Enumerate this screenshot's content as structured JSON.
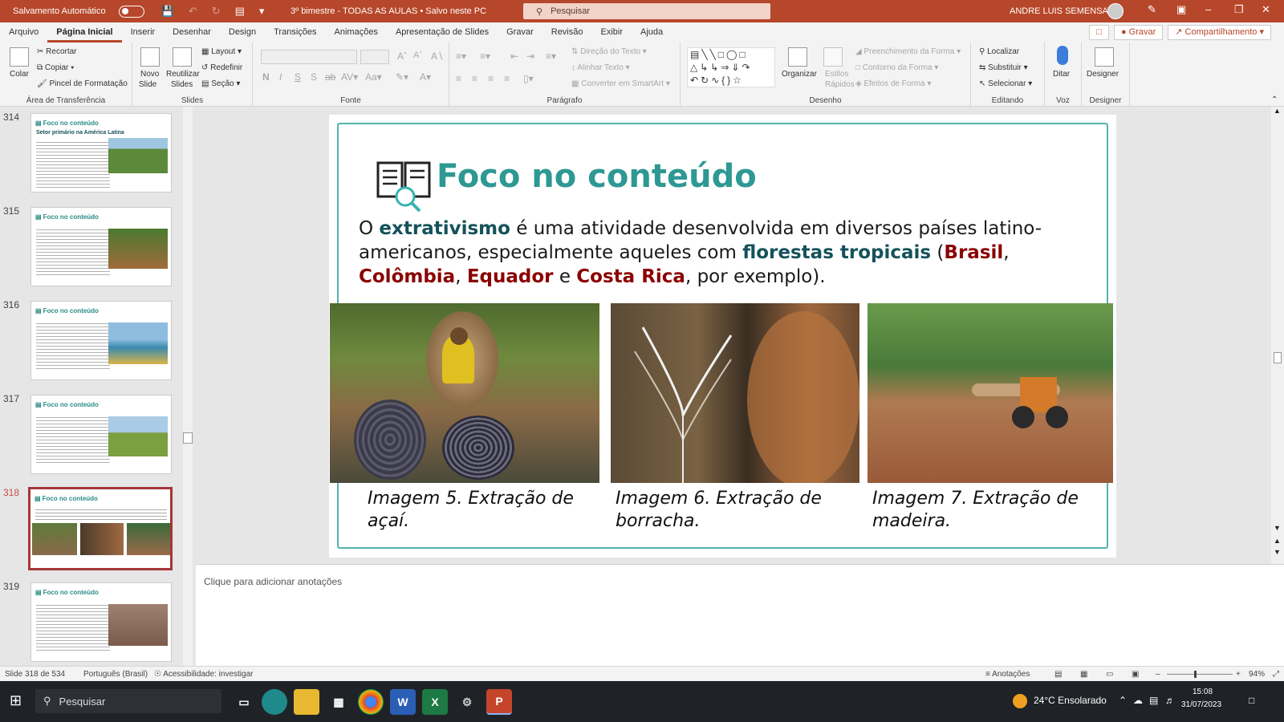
{
  "titlebar": {
    "autosave_label": "Salvamento Automático",
    "doc_title": "3º bimestre - TODAS AS AULAS • Salvo neste PC",
    "search_placeholder": "Pesquisar",
    "user_name": "ANDRE LUIS SEMENSATO"
  },
  "menu": {
    "tabs": [
      "Arquivo",
      "Página Inicial",
      "Inserir",
      "Desenhar",
      "Design",
      "Transições",
      "Animações",
      "Apresentação de Slides",
      "Gravar",
      "Revisão",
      "Exibir",
      "Ajuda"
    ],
    "record_label": "Gravar",
    "share_label": "Compartilhamento"
  },
  "ribbon": {
    "clipboard": {
      "paste": "Colar",
      "cut": "Recortar",
      "copy": "Copiar",
      "format_painter": "Pincel de Formatação",
      "label": "Área de Transferência"
    },
    "slides": {
      "new_slide_line1": "Novo",
      "new_slide_line2": "Slide",
      "reuse_line1": "Reutilizar",
      "reuse_line2": "Slides",
      "layout": "Layout",
      "reset": "Redefinir",
      "section": "Seção",
      "label": "Slides"
    },
    "font": {
      "label": "Fonte",
      "bold": "N",
      "italic": "I",
      "underline": "S"
    },
    "paragraph": {
      "text_direction": "Direção do Texto",
      "align_text": "Alinhar Texto",
      "smartart": "Converter em SmartArt",
      "label": "Parágrafo"
    },
    "drawing": {
      "arrange": "Organizar",
      "quick_styles_line1": "Estilos",
      "quick_styles_line2": "Rápidos",
      "shape_fill": "Preenchimento da Forma",
      "shape_outline": "Contorno da Forma",
      "shape_effects": "Efeitos de Forma",
      "label": "Desenho"
    },
    "editing": {
      "find": "Localizar",
      "replace": "Substituir",
      "select": "Selecionar",
      "label": "Editando"
    },
    "voice": {
      "dictate": "Ditar",
      "label": "Voz"
    },
    "designer": {
      "designer": "Designer",
      "label": "Designer"
    }
  },
  "thumbnails": [
    {
      "num": "314",
      "title": "Foco no conteúdo",
      "subtitle": "Setor primário na América Latina",
      "selected": false
    },
    {
      "num": "315",
      "title": "Foco no conteúdo",
      "subtitle": "",
      "selected": false
    },
    {
      "num": "316",
      "title": "Foco no conteúdo",
      "subtitle": "",
      "selected": false
    },
    {
      "num": "317",
      "title": "Foco no conteúdo",
      "subtitle": "",
      "selected": false
    },
    {
      "num": "318",
      "title": "Foco no conteúdo",
      "subtitle": "",
      "selected": true
    },
    {
      "num": "319",
      "title": "Foco no conteúdo",
      "subtitle": "",
      "selected": false
    }
  ],
  "slide": {
    "title": "Foco no conteúdo",
    "body": {
      "p1": "O ",
      "extrativismo": "extrativismo",
      "p2": " é uma atividade desenvolvida em diversos países latino-americanos, especialmente aqueles com ",
      "florestas": "florestas tropicais",
      "p3": " (",
      "brasil": "Brasil",
      "sep1": ", ",
      "colombia": "Colômbia",
      "sep2": ", ",
      "equador": "Equador",
      "sep3": " e ",
      "costarica": "Costa Rica",
      "p4": ", por exemplo)."
    },
    "captions": [
      "Imagem 5. Extração de açaí.",
      "Imagem 6. Extração de borracha.",
      "Imagem 7. Extração de madeira."
    ]
  },
  "notes_placeholder": "Clique para adicionar anotações",
  "status": {
    "slide_count": "Slide 318 de 534",
    "language": "Português (Brasil)",
    "accessibility": "Acessibilidade: investigar",
    "notes_btn": "Anotações",
    "zoom": "94%"
  },
  "taskbar": {
    "search": "Pesquisar",
    "weather": "24°C  Ensolarado",
    "time": "15:08",
    "date": "31/07/2023"
  },
  "colors": {
    "accent": "#b7472a",
    "teal": "#2e9893",
    "dark_teal": "#15525a",
    "dark_red": "#8b0000"
  }
}
